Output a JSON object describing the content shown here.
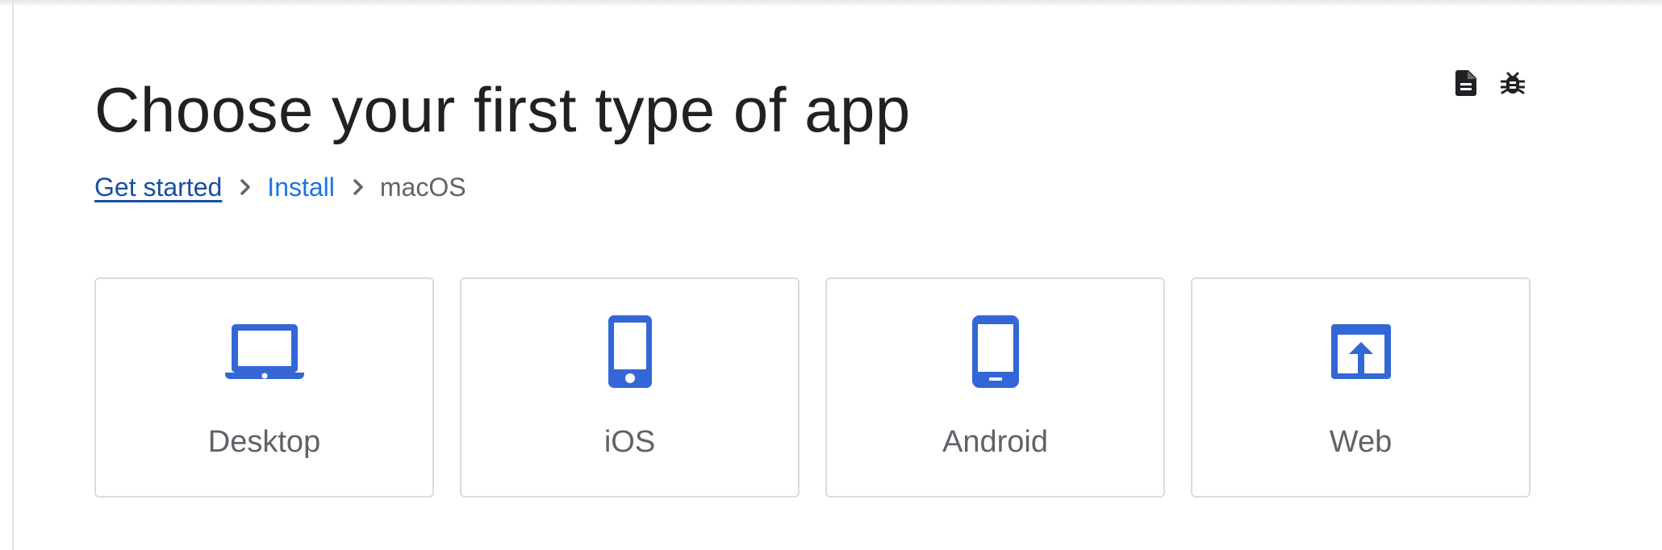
{
  "page": {
    "title": "Choose your first type of app"
  },
  "header_actions": [
    {
      "icon": "document-icon"
    },
    {
      "icon": "bug-icon"
    }
  ],
  "breadcrumb": {
    "items": [
      {
        "label": "Get started"
      },
      {
        "label": "Install"
      },
      {
        "label": "macOS"
      }
    ]
  },
  "app_types": [
    {
      "label": "Desktop",
      "icon": "laptop-icon"
    },
    {
      "label": "iOS",
      "icon": "iphone-icon"
    },
    {
      "label": "Android",
      "icon": "android-phone-icon"
    },
    {
      "label": "Web",
      "icon": "web-open-in-browser-icon"
    }
  ],
  "colors": {
    "accent": "#3367d6",
    "link": "#1a73e8",
    "visited_link": "#174ea6",
    "muted_text": "#5f6368",
    "card_border": "#dadce0"
  }
}
